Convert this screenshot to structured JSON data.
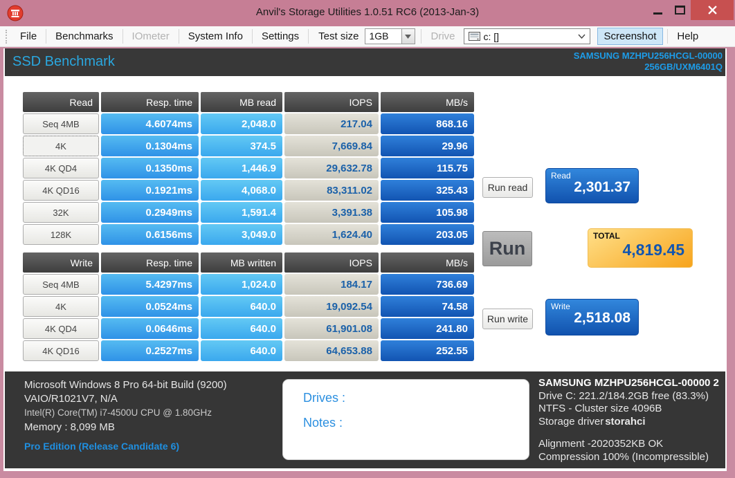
{
  "window": {
    "title": "Anvil's Storage Utilities 1.0.51 RC6 (2013-Jan-3)"
  },
  "menu": {
    "items": [
      {
        "label": "File"
      },
      {
        "label": "Benchmarks"
      },
      {
        "label": "IOmeter"
      },
      {
        "label": "System Info"
      },
      {
        "label": "Settings"
      }
    ],
    "test_size_label": "Test size",
    "test_size_value": "1GB",
    "drive_label": "Drive",
    "drive_value": "c: []",
    "screenshot_label": "Screenshot",
    "help_label": "Help"
  },
  "banner": {
    "title": "SSD Benchmark",
    "device_line1": "SAMSUNG MZHPU256HCGL-00000",
    "device_line2": "256GB/UXM6401Q"
  },
  "read_table": {
    "headers": [
      "Read",
      "Resp. time",
      "MB read",
      "IOPS",
      "MB/s"
    ],
    "rows": [
      {
        "label": "Seq 4MB",
        "resp": "4.6074ms",
        "mb": "2,048.0",
        "iops": "217.04",
        "mbs": "868.16"
      },
      {
        "label": "4K",
        "resp": "0.1304ms",
        "mb": "374.5",
        "iops": "7,669.84",
        "mbs": "29.96"
      },
      {
        "label": "4K QD4",
        "resp": "0.1350ms",
        "mb": "1,446.9",
        "iops": "29,632.78",
        "mbs": "115.75"
      },
      {
        "label": "4K QD16",
        "resp": "0.1921ms",
        "mb": "4,068.0",
        "iops": "83,311.02",
        "mbs": "325.43"
      },
      {
        "label": "32K",
        "resp": "0.2949ms",
        "mb": "1,591.4",
        "iops": "3,391.38",
        "mbs": "105.98"
      },
      {
        "label": "128K",
        "resp": "0.6156ms",
        "mb": "3,049.0",
        "iops": "1,624.40",
        "mbs": "203.05"
      }
    ]
  },
  "write_table": {
    "headers": [
      "Write",
      "Resp. time",
      "MB written",
      "IOPS",
      "MB/s"
    ],
    "rows": [
      {
        "label": "Seq 4MB",
        "resp": "5.4297ms",
        "mb": "1,024.0",
        "iops": "184.17",
        "mbs": "736.69"
      },
      {
        "label": "4K",
        "resp": "0.0524ms",
        "mb": "640.0",
        "iops": "19,092.54",
        "mbs": "74.58"
      },
      {
        "label": "4K QD4",
        "resp": "0.0646ms",
        "mb": "640.0",
        "iops": "61,901.08",
        "mbs": "241.80"
      },
      {
        "label": "4K QD16",
        "resp": "0.2527ms",
        "mb": "640.0",
        "iops": "64,653.88",
        "mbs": "252.55"
      }
    ]
  },
  "actions": {
    "run_read": "Run read",
    "run": "Run",
    "run_write": "Run write"
  },
  "scores": {
    "read": {
      "label": "Read",
      "value": "2,301.37"
    },
    "total": {
      "label": "TOTAL",
      "value": "4,819.45"
    },
    "write": {
      "label": "Write",
      "value": "2,518.08"
    }
  },
  "system_info": {
    "os": "Microsoft Windows 8 Pro 64-bit Build (9200)",
    "machine": "VAIO/R1021V7, N/A",
    "cpu": "Intel(R) Core(TM) i7-4500U CPU @ 1.80GHz",
    "memory": "Memory : 8,099 MB",
    "edition": "Pro Edition (Release Candidate 6)"
  },
  "notes": {
    "drives_label": "Drives :",
    "notes_label": "Notes :"
  },
  "drive_info": {
    "model": "SAMSUNG MZHPU256HCGL-00000 2",
    "capacity": "Drive C: 221.2/184.2GB free (83.3%)",
    "filesystem": "NTFS - Cluster size 4096B",
    "driver_prefix": "Storage driver",
    "driver_name": "storahci",
    "alignment": "Alignment -2020352KB OK",
    "compression": "Compression 100% (Incompressible)"
  },
  "colors": {
    "titlebar_pink": "#c67e95",
    "accent_blue": "#1d9ce8",
    "score_blue": "#1152ae",
    "total_orange": "#f7a41c",
    "panel_dark": "#363636"
  }
}
